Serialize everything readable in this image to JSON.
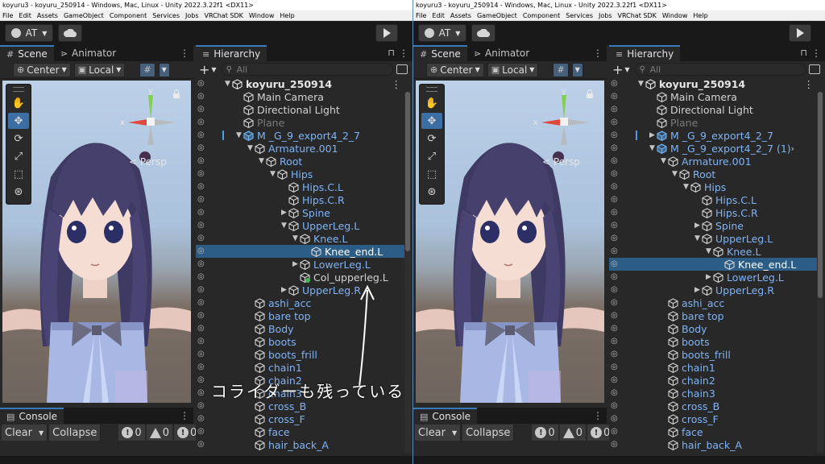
{
  "window": {
    "title": "koyuru3 - koyuru_250914 - Windows, Mac, Linux - Unity 2022.3.22f1 <DX11>"
  },
  "menu": [
    "File",
    "Edit",
    "Assets",
    "GameObject",
    "Component",
    "Services",
    "Jobs",
    "VRChat SDK",
    "Window",
    "Help"
  ],
  "toolbar": {
    "account_label": "AT",
    "account_icon": "account-circle-icon",
    "cloud_icon": "cloud-icon",
    "play_icon": "play-icon"
  },
  "scene": {
    "tabs": [
      {
        "label": "Scene",
        "icon": "grid-icon"
      },
      {
        "label": "Animator",
        "icon": "animator-icon"
      }
    ],
    "pivot_label": "Center",
    "space_label": "Local",
    "persp_label": "< Persp",
    "gizmo": {
      "x": "x",
      "y": "y"
    },
    "tools": [
      "hand-tool-icon",
      "move-tool-icon",
      "rotate-tool-icon",
      "scale-tool-icon",
      "rect-tool-icon",
      "transform-tool-icon"
    ]
  },
  "console": {
    "tab_label": "Console",
    "clear_label": "Clear",
    "collapse_label": "Collapse",
    "info_count": "0",
    "warning_count": "0",
    "error_count": "0"
  },
  "hierarchy": {
    "tab_label": "Hierarchy",
    "search_placeholder": "All"
  },
  "left_tree": [
    {
      "label": "koyuru_250914",
      "depth": 0,
      "arrow": "down",
      "style": "bold",
      "icon": "unity-scene-icon"
    },
    {
      "label": "Main Camera",
      "depth": 1,
      "arrow": "",
      "style": "normal",
      "icon": "gameobject-icon"
    },
    {
      "label": "Directional Light",
      "depth": 1,
      "arrow": "",
      "style": "normal",
      "icon": "gameobject-icon"
    },
    {
      "label": "Plane",
      "depth": 1,
      "arrow": "",
      "style": "grey",
      "icon": "gameobject-icon"
    },
    {
      "label": "M _G_9_export4_2_7",
      "depth": 1,
      "arrow": "down",
      "style": "blue",
      "icon": "prefab-icon",
      "prefab": true
    },
    {
      "label": "Armature.001",
      "depth": 2,
      "arrow": "down",
      "style": "blue",
      "icon": "gameobject-icon"
    },
    {
      "label": "Root",
      "depth": 3,
      "arrow": "down",
      "style": "blue",
      "icon": "gameobject-icon"
    },
    {
      "label": "Hips",
      "depth": 4,
      "arrow": "down",
      "style": "blue",
      "icon": "gameobject-icon"
    },
    {
      "label": "Hips.C.L",
      "depth": 5,
      "arrow": "",
      "style": "blue",
      "icon": "gameobject-icon"
    },
    {
      "label": "Hips.C.R",
      "depth": 5,
      "arrow": "",
      "style": "blue",
      "icon": "gameobject-icon"
    },
    {
      "label": "Spine",
      "depth": 5,
      "arrow": "right",
      "style": "blue",
      "icon": "gameobject-icon"
    },
    {
      "label": "UpperLeg.L",
      "depth": 5,
      "arrow": "down",
      "style": "blue",
      "icon": "gameobject-icon"
    },
    {
      "label": "Knee.L",
      "depth": 6,
      "arrow": "down",
      "style": "blue",
      "icon": "gameobject-icon"
    },
    {
      "label": "Knee_end.L",
      "depth": 7,
      "arrow": "",
      "style": "selected",
      "icon": "gameobject-icon",
      "selected": true
    },
    {
      "label": "LowerLeg.L",
      "depth": 6,
      "arrow": "right",
      "style": "blue",
      "icon": "gameobject-icon"
    },
    {
      "label": "Col_upperleg.L",
      "depth": 6,
      "arrow": "",
      "style": "normal",
      "icon": "added-gameobject-icon"
    },
    {
      "label": "UpperLeg.R",
      "depth": 5,
      "arrow": "right",
      "style": "blue",
      "icon": "gameobject-icon"
    },
    {
      "label": "ashi_acc",
      "depth": 2,
      "arrow": "",
      "style": "blue",
      "icon": "gameobject-icon"
    },
    {
      "label": "bare top",
      "depth": 2,
      "arrow": "",
      "style": "blue",
      "icon": "gameobject-icon"
    },
    {
      "label": "Body",
      "depth": 2,
      "arrow": "",
      "style": "blue",
      "icon": "gameobject-icon"
    },
    {
      "label": "boots",
      "depth": 2,
      "arrow": "",
      "style": "blue",
      "icon": "gameobject-icon"
    },
    {
      "label": "boots_frill",
      "depth": 2,
      "arrow": "",
      "style": "blue",
      "icon": "gameobject-icon"
    },
    {
      "label": "chain1",
      "depth": 2,
      "arrow": "",
      "style": "blue",
      "icon": "gameobject-icon"
    },
    {
      "label": "chain2",
      "depth": 2,
      "arrow": "",
      "style": "blue",
      "icon": "gameobject-icon"
    },
    {
      "label": "chain3",
      "depth": 2,
      "arrow": "",
      "style": "blue",
      "icon": "gameobject-icon"
    },
    {
      "label": "cross_B",
      "depth": 2,
      "arrow": "",
      "style": "blue",
      "icon": "gameobject-icon"
    },
    {
      "label": "cross_F",
      "depth": 2,
      "arrow": "",
      "style": "blue",
      "icon": "gameobject-icon"
    },
    {
      "label": "face",
      "depth": 2,
      "arrow": "",
      "style": "blue",
      "icon": "gameobject-icon"
    },
    {
      "label": "hair_back_A",
      "depth": 2,
      "arrow": "",
      "style": "blue",
      "icon": "gameobject-icon"
    }
  ],
  "right_tree": [
    {
      "label": "koyuru_250914",
      "depth": 0,
      "arrow": "down",
      "style": "bold",
      "icon": "unity-scene-icon"
    },
    {
      "label": "Main Camera",
      "depth": 1,
      "arrow": "",
      "style": "normal",
      "icon": "gameobject-icon"
    },
    {
      "label": "Directional Light",
      "depth": 1,
      "arrow": "",
      "style": "normal",
      "icon": "gameobject-icon"
    },
    {
      "label": "Plane",
      "depth": 1,
      "arrow": "",
      "style": "grey",
      "icon": "gameobject-icon"
    },
    {
      "label": "M _G_9_export4_2_7",
      "depth": 1,
      "arrow": "right",
      "style": "blue",
      "icon": "prefab-icon",
      "prefab": true
    },
    {
      "label": "M _G_9_export4_2_7 (1)",
      "depth": 1,
      "arrow": "down",
      "style": "blue",
      "icon": "prefab-icon",
      "chevron": true
    },
    {
      "label": "Armature.001",
      "depth": 2,
      "arrow": "down",
      "style": "blue",
      "icon": "gameobject-icon"
    },
    {
      "label": "Root",
      "depth": 3,
      "arrow": "down",
      "style": "blue",
      "icon": "gameobject-icon"
    },
    {
      "label": "Hips",
      "depth": 4,
      "arrow": "down",
      "style": "blue",
      "icon": "gameobject-icon"
    },
    {
      "label": "Hips.C.L",
      "depth": 5,
      "arrow": "",
      "style": "blue",
      "icon": "gameobject-icon"
    },
    {
      "label": "Hips.C.R",
      "depth": 5,
      "arrow": "",
      "style": "blue",
      "icon": "gameobject-icon"
    },
    {
      "label": "Spine",
      "depth": 5,
      "arrow": "right",
      "style": "blue",
      "icon": "gameobject-icon"
    },
    {
      "label": "UpperLeg.L",
      "depth": 5,
      "arrow": "down",
      "style": "blue",
      "icon": "gameobject-icon"
    },
    {
      "label": "Knee.L",
      "depth": 6,
      "arrow": "down",
      "style": "blue",
      "icon": "gameobject-icon"
    },
    {
      "label": "Knee_end.L",
      "depth": 7,
      "arrow": "",
      "style": "selected",
      "icon": "gameobject-icon",
      "selected": true
    },
    {
      "label": "LowerLeg.L",
      "depth": 6,
      "arrow": "right",
      "style": "blue",
      "icon": "gameobject-icon"
    },
    {
      "label": "UpperLeg.R",
      "depth": 5,
      "arrow": "right",
      "style": "blue",
      "icon": "gameobject-icon"
    },
    {
      "label": "ashi_acc",
      "depth": 2,
      "arrow": "",
      "style": "blue",
      "icon": "gameobject-icon"
    },
    {
      "label": "bare top",
      "depth": 2,
      "arrow": "",
      "style": "blue",
      "icon": "gameobject-icon"
    },
    {
      "label": "Body",
      "depth": 2,
      "arrow": "",
      "style": "blue",
      "icon": "gameobject-icon"
    },
    {
      "label": "boots",
      "depth": 2,
      "arrow": "",
      "style": "blue",
      "icon": "gameobject-icon"
    },
    {
      "label": "boots_frill",
      "depth": 2,
      "arrow": "",
      "style": "blue",
      "icon": "gameobject-icon"
    },
    {
      "label": "chain1",
      "depth": 2,
      "arrow": "",
      "style": "blue",
      "icon": "gameobject-icon"
    },
    {
      "label": "chain2",
      "depth": 2,
      "arrow": "",
      "style": "blue",
      "icon": "gameobject-icon"
    },
    {
      "label": "chain3",
      "depth": 2,
      "arrow": "",
      "style": "blue",
      "icon": "gameobject-icon"
    },
    {
      "label": "cross_B",
      "depth": 2,
      "arrow": "",
      "style": "blue",
      "icon": "gameobject-icon"
    },
    {
      "label": "cross_F",
      "depth": 2,
      "arrow": "",
      "style": "blue",
      "icon": "gameobject-icon"
    },
    {
      "label": "face",
      "depth": 2,
      "arrow": "",
      "style": "blue",
      "icon": "gameobject-icon"
    },
    {
      "label": "hair_back_A",
      "depth": 2,
      "arrow": "",
      "style": "blue",
      "icon": "gameobject-icon"
    }
  ],
  "annotation": {
    "text": "コライダーも残っている"
  },
  "colors": {
    "selection": "#2c5d87",
    "prefab_blue": "#7fb3f5",
    "tab_accent": "#3a79bb",
    "editor_bg": "#282828"
  }
}
